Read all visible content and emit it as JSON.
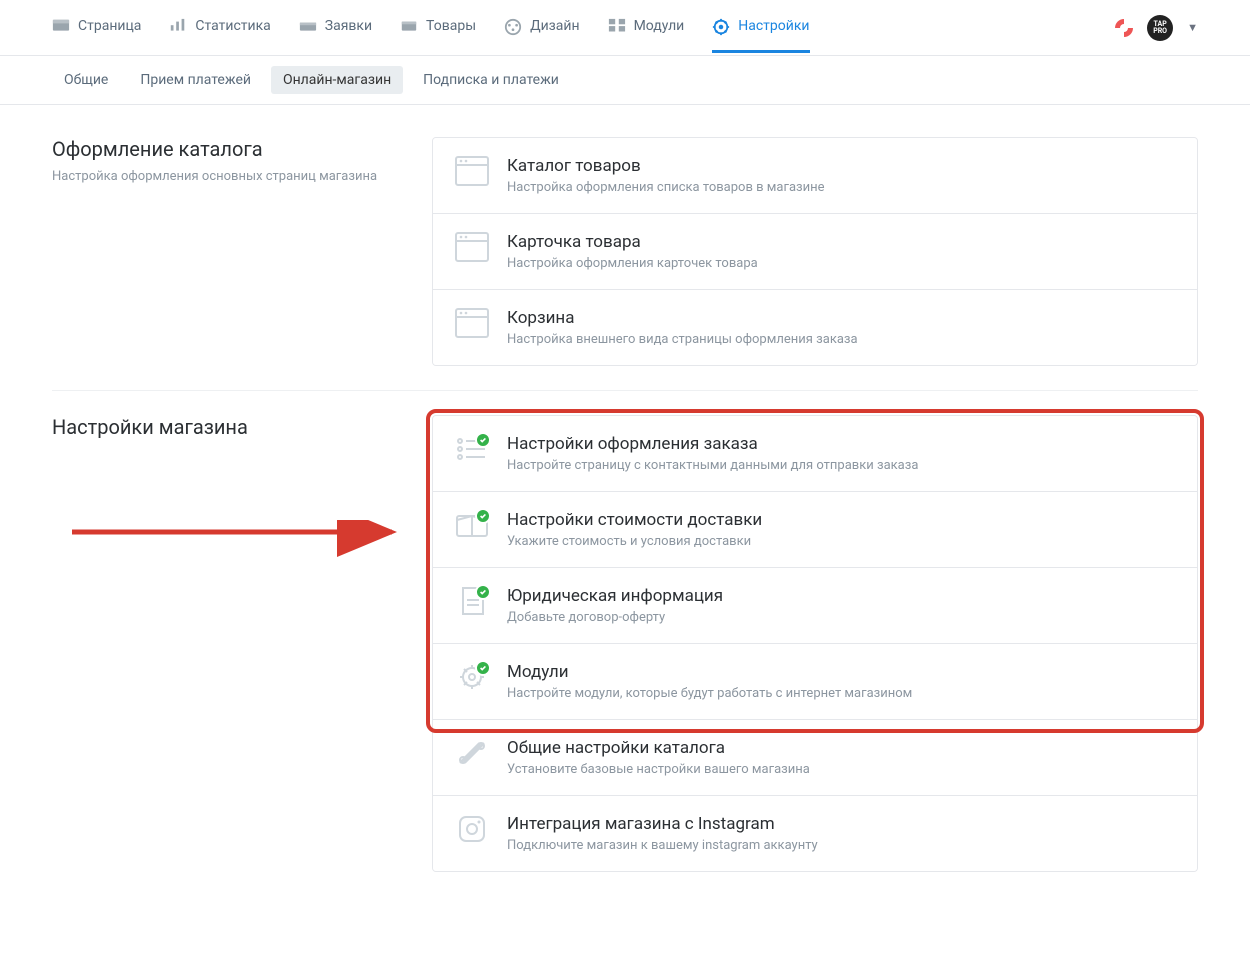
{
  "topnav": {
    "items": [
      {
        "label": "Страница",
        "icon": "page"
      },
      {
        "label": "Статистика",
        "icon": "stats"
      },
      {
        "label": "Заявки",
        "icon": "orders"
      },
      {
        "label": "Товары",
        "icon": "products"
      },
      {
        "label": "Дизайн",
        "icon": "design"
      },
      {
        "label": "Модули",
        "icon": "modules"
      },
      {
        "label": "Настройки",
        "icon": "settings",
        "active": true
      }
    ],
    "avatar_text": "TAP\nPRO"
  },
  "subnav": {
    "items": [
      {
        "label": "Общие"
      },
      {
        "label": "Прием платежей"
      },
      {
        "label": "Онлайн-магазин",
        "active": true
      },
      {
        "label": "Подписка и платежи"
      }
    ]
  },
  "sections": [
    {
      "title": "Оформление каталога",
      "desc": "Настройка оформления основных страниц магазина",
      "cards": [
        {
          "title": "Каталог товаров",
          "desc": "Настройка оформления списка товаров в магазине",
          "icon": "window"
        },
        {
          "title": "Карточка товара",
          "desc": "Настройка оформления карточек товара",
          "icon": "window"
        },
        {
          "title": "Корзина",
          "desc": "Настройка внешнего вида страницы оформления заказа",
          "icon": "window"
        }
      ]
    },
    {
      "title": "Настройки магазина",
      "desc": "",
      "highlight_first_n": 4,
      "cards": [
        {
          "title": "Настройки оформления заказа",
          "desc": "Настройте страницу с контактными данными для отправки заказа",
          "icon": "list",
          "badge": true
        },
        {
          "title": "Настройки стоимости доставки",
          "desc": "Укажите стоимость и условия доставки",
          "icon": "box",
          "badge": true
        },
        {
          "title": "Юридическая информация",
          "desc": "Добавьте договор-оферту",
          "icon": "doc",
          "badge": true
        },
        {
          "title": "Модули",
          "desc": "Настройте модули, которые будут работать с интернет магазином",
          "icon": "gear",
          "badge": true
        },
        {
          "title": "Общие настройки каталога",
          "desc": "Установите базовые настройки вашего магазина",
          "icon": "tools"
        },
        {
          "title": "Интеграция магазина с Instagram",
          "desc": "Подключите магазин к вашему instagram аккаунту",
          "icon": "insta"
        }
      ]
    }
  ]
}
